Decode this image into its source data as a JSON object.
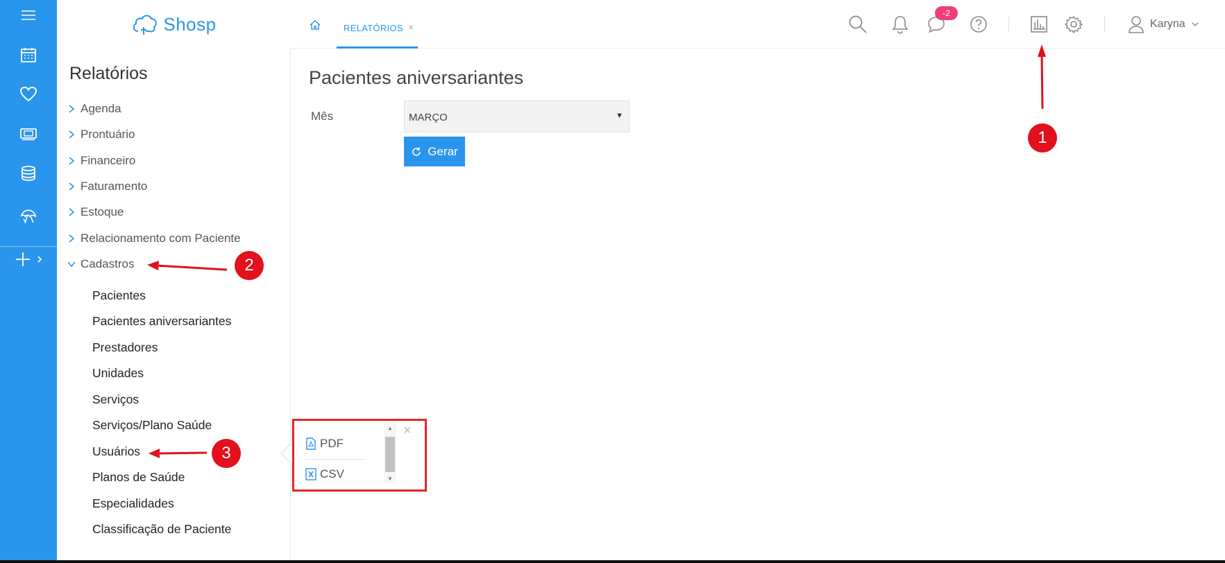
{
  "app": {
    "logo_text": "Shosp"
  },
  "rail": {
    "icons": [
      "menu-icon",
      "calendar-icon",
      "heart-icon",
      "money-icon",
      "database-icon",
      "umbrella-icon",
      "plus-icon"
    ]
  },
  "sidebar": {
    "title": "Relatórios",
    "items": [
      {
        "label": "Agenda"
      },
      {
        "label": "Prontuário"
      },
      {
        "label": "Financeiro"
      },
      {
        "label": "Faturamento"
      },
      {
        "label": "Estoque"
      },
      {
        "label": "Relacionamento com Paciente"
      },
      {
        "label": "Cadastros",
        "expanded": true
      }
    ],
    "sub_items": [
      {
        "label": "Pacientes"
      },
      {
        "label": "Pacientes aniversariantes"
      },
      {
        "label": "Prestadores"
      },
      {
        "label": "Unidades"
      },
      {
        "label": "Serviços"
      },
      {
        "label": "Serviços/Plano Saúde"
      },
      {
        "label": "Usuários"
      },
      {
        "label": "Planos de Saúde"
      },
      {
        "label": "Especialidades"
      },
      {
        "label": "Classificação de Paciente"
      }
    ]
  },
  "header": {
    "tab_label": "RELATÓRIOS",
    "tab_close": "×",
    "messages_badge": "-2",
    "user_name": "Karyna",
    "accent": "#2a95ec",
    "badge_color": "#ee3f74"
  },
  "main": {
    "title": "Pacientes aniversariantes",
    "month_label": "Mês",
    "month_value": "MARÇO",
    "generate_label": "Gerar"
  },
  "export_popup": {
    "options": [
      {
        "label": "PDF"
      },
      {
        "label": "CSV"
      }
    ],
    "close": "×"
  },
  "annotations": {
    "markers": [
      "1",
      "2",
      "3"
    ],
    "color": "#e2111b"
  }
}
